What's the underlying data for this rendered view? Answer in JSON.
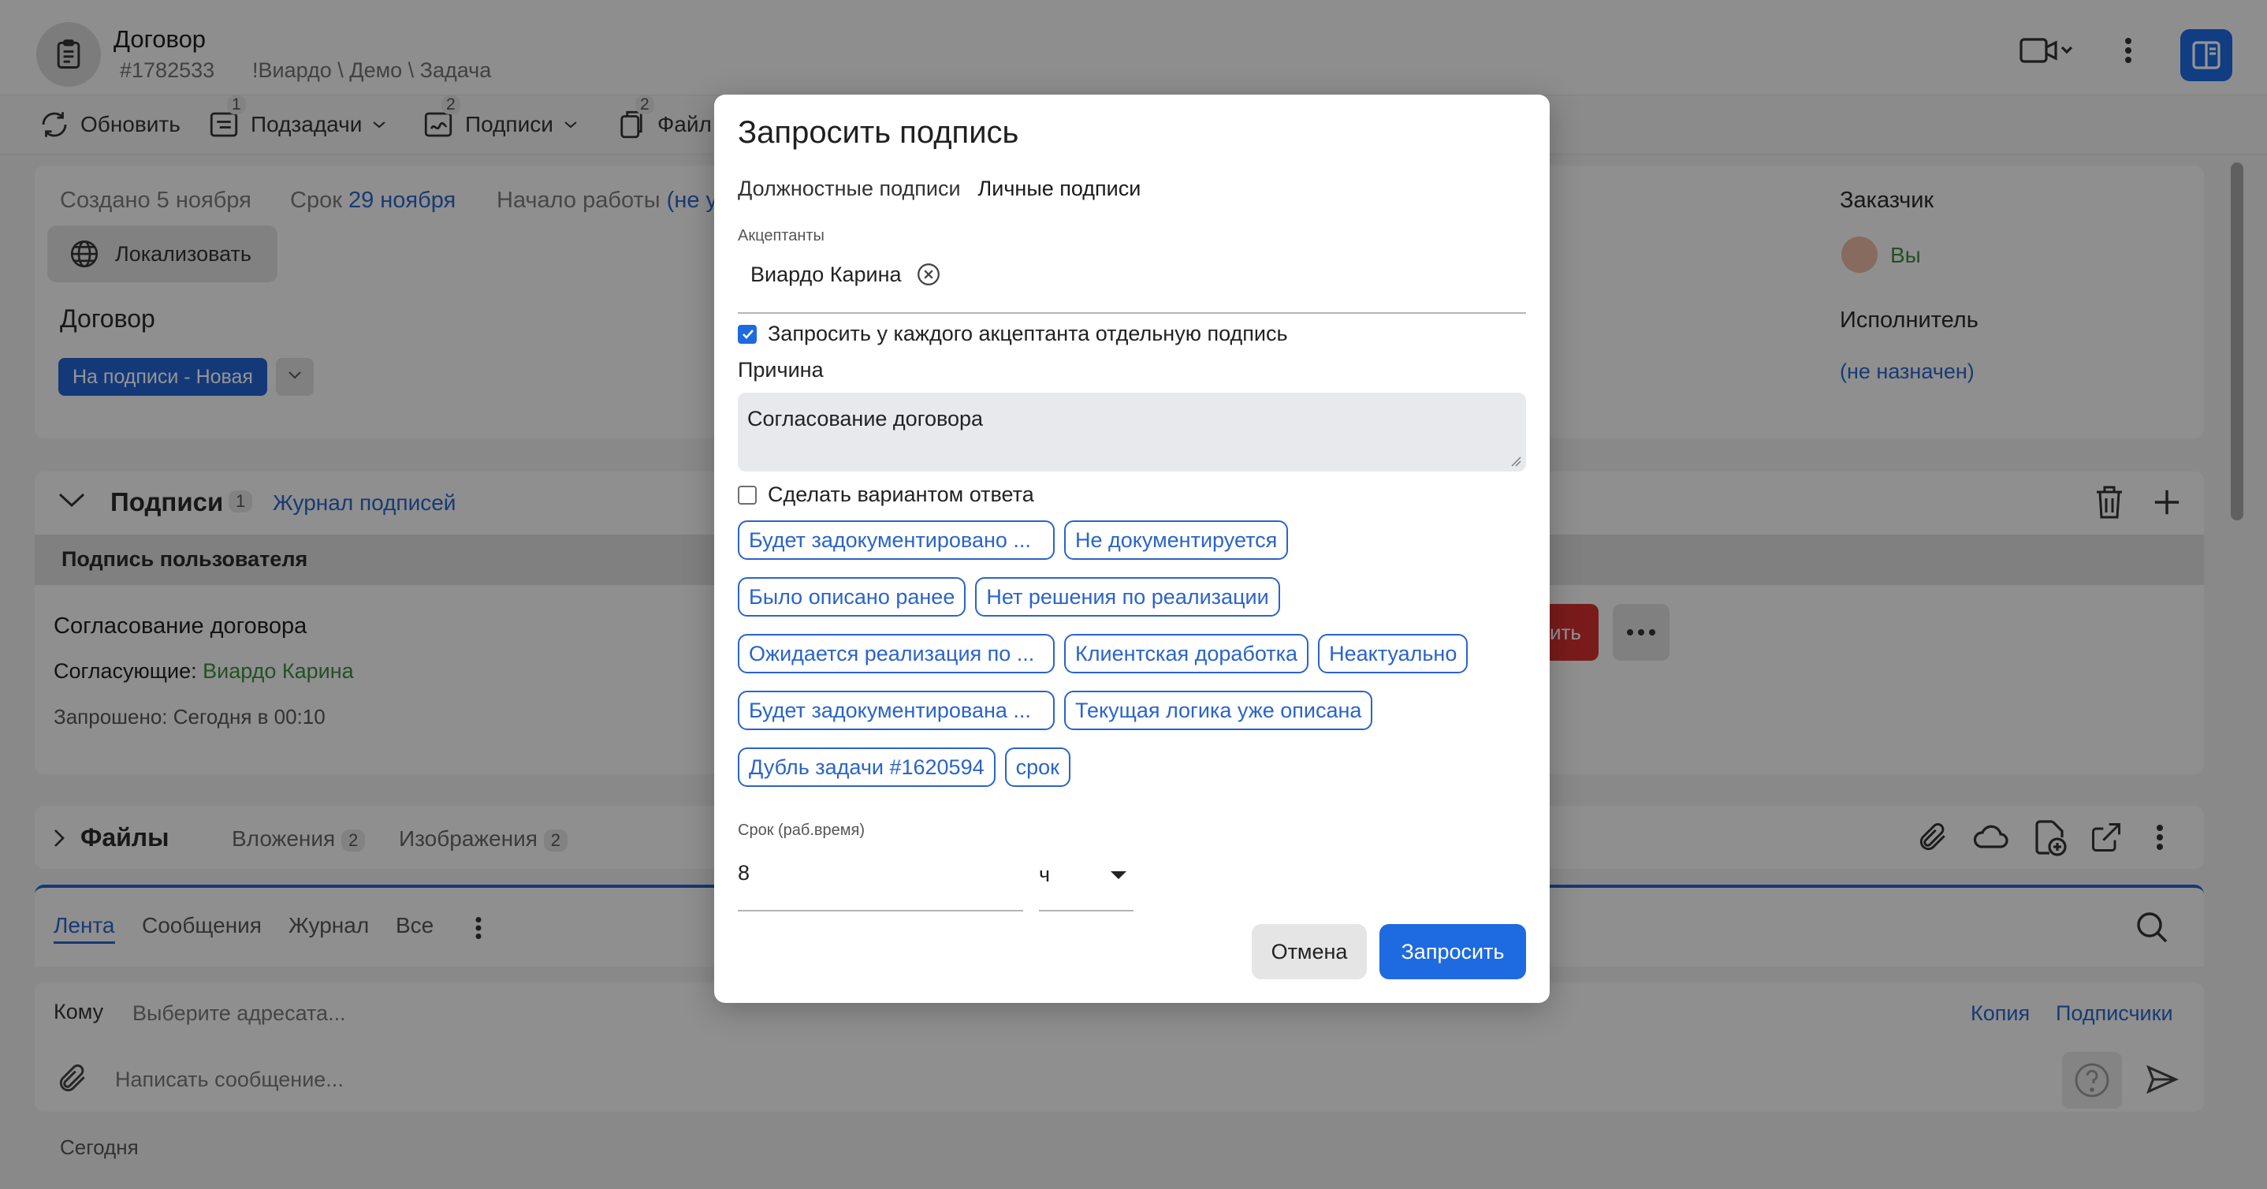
{
  "header": {
    "title": "Договор",
    "id": "#1782533",
    "path": "!Виардо \\ Демо \\ Задача"
  },
  "toolbar": {
    "refresh": "Обновить",
    "subtasks": "Подзадачи",
    "subtasks_count": "1",
    "signatures": "Подписи",
    "signatures_count": "2",
    "files": "Файл",
    "files_count": "2"
  },
  "info": {
    "created": "Создано 5 ноября",
    "due_prefix": "Срок",
    "due_date": "29 ноября",
    "start_prefix": "Начало работы",
    "start_value": "(не у",
    "localize": "Локализовать",
    "heading": "Договор",
    "status": "На подписи - Новая",
    "customer_label": "Заказчик",
    "customer_value": "Вы",
    "executor_label": "Исполнитель",
    "executor_value": "(не назначен)"
  },
  "signatures_card": {
    "title": "Подписи",
    "count": "1",
    "journal": "Журнал подписей",
    "column_header": "Подпись пользователя",
    "item_title": "Согласование договора",
    "approvers_label": "Согласующие:",
    "approvers_value": "Виардо Карина",
    "requested": "Запрошено: Сегодня в 00:10",
    "cut_button": "ить"
  },
  "files_card": {
    "title": "Файлы",
    "attachments": "Вложения",
    "attachments_count": "2",
    "images": "Изображения",
    "images_count": "2"
  },
  "feed": {
    "tabs": [
      "Лента",
      "Сообщения",
      "Журнал",
      "Все"
    ]
  },
  "compose": {
    "to_label": "Кому",
    "to_placeholder": "Выберите адресата...",
    "copy": "Копия",
    "subscribers": "Подписчики",
    "message_placeholder": "Написать сообщение...",
    "today": "Сегодня"
  },
  "modal": {
    "title": "Запросить подпись",
    "tab_position": "Должностные подписи",
    "tab_personal": "Личные подписи",
    "acceptants_label": "Акцептанты",
    "acceptant": "Виардо Карина",
    "separate_checkbox": "Запросить у каждого акцептанта отдельную подпись",
    "reason_label": "Причина",
    "reason_value": "Согласование договора",
    "make_option_checkbox": "Сделать вариантом ответа",
    "chips": [
      [
        "Будет задокументировано ...",
        "Не документируется"
      ],
      [
        "Было описано ранее",
        "Нет решения по реализации"
      ],
      [
        "Ожидается реализация по ...",
        "Клиентская доработка",
        "Неактуально"
      ],
      [
        "Будет задокументирована ...",
        "Текущая логика уже описана"
      ],
      [
        "Дубль задачи #1620594",
        "срок"
      ]
    ],
    "due_label": "Срок (раб.время)",
    "due_value": "8",
    "unit_value": "ч",
    "cancel": "Отмена",
    "submit": "Запросить"
  },
  "colors": {
    "accent": "#1e6ae0",
    "link": "#2a64c9",
    "success": "#3e8a3e"
  }
}
